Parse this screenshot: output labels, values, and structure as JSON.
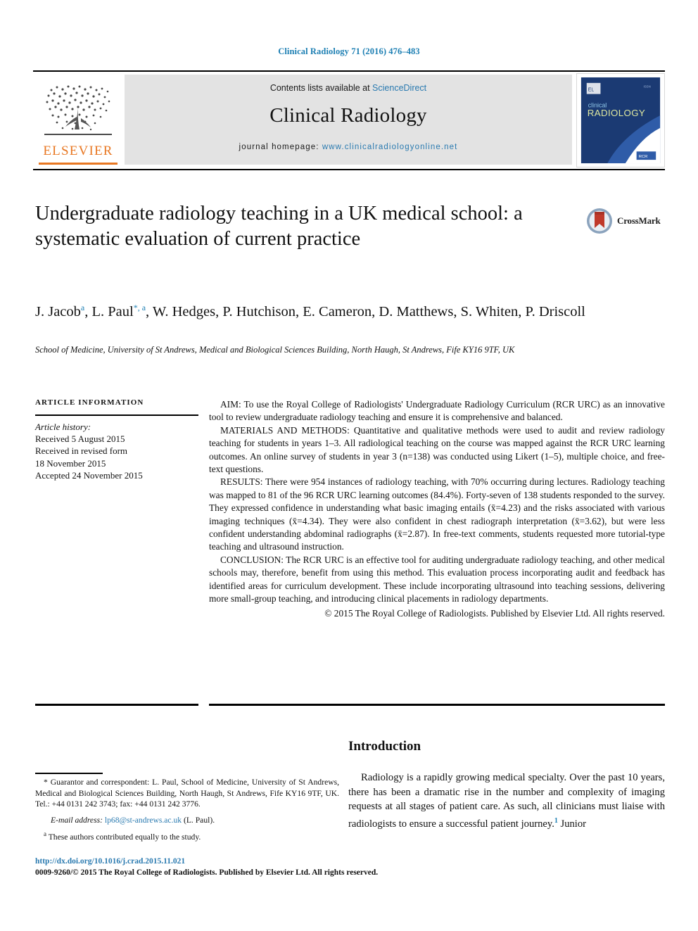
{
  "running_head": "Clinical Radiology 71 (2016) 476–483",
  "masthead": {
    "publisher_name": "ELSEVIER",
    "contents_prefix": "Contents lists available at ",
    "contents_link": "ScienceDirect",
    "journal_name": "Clinical Radiology",
    "homepage_prefix": "journal homepage: ",
    "homepage_url": "www.clinicalradiologyonline.net",
    "cover_title_small": "clinical",
    "cover_title_large": "RADIOLOGY",
    "accent_blue": "#2a7ab0",
    "elsevier_orange": "#e87722",
    "band_grey": "#e3e3e3"
  },
  "article": {
    "title": "Undergraduate radiology teaching in a UK medical school: a systematic evaluation of current practice",
    "crossmark_label": "CrossMark",
    "authors_line_1": "J. Jacob",
    "authors_sup_1": "a",
    "authors_line_2": ", L. Paul",
    "authors_sup_2": "*, a",
    "authors_line_3": ", W. Hedges, P. Hutchison, E. Cameron, D. Matthews, S. Whiten, P. Driscoll",
    "affiliation": "School of Medicine, University of St Andrews, Medical and Biological Sciences Building, North Haugh, St Andrews, Fife KY16 9TF, UK"
  },
  "article_information": {
    "heading": "ARTICLE INFORMATION",
    "history_label": "Article history:",
    "history_lines": [
      "Received 5 August 2015",
      "Received in revised form",
      "18 November 2015",
      "Accepted 24 November 2015"
    ]
  },
  "abstract": {
    "aim": "AIM: To use the Royal College of Radiologists' Undergraduate Radiology Curriculum (RCR URC) as an innovative tool to review undergraduate radiology teaching and ensure it is comprehensive and balanced.",
    "materials_and_methods": "MATERIALS AND METHODS: Quantitative and qualitative methods were used to audit and review radiology teaching for students in years 1–3. All radiological teaching on the course was mapped against the RCR URC learning outcomes. An online survey of students in year 3 (n=138) was conducted using Likert (1–5), multiple choice, and free-text questions.",
    "results": "RESULTS: There were 954 instances of radiology teaching, with 70% occurring during lectures. Radiology teaching was mapped to 81 of the 96 RCR URC learning outcomes (84.4%). Forty-seven of 138 students responded to the survey. They expressed confidence in understanding what basic imaging entails (x̄=4.23) and the risks associated with various imaging techniques (x̄=4.34). They were also confident in chest radiograph interpretation (x̄=3.62), but were less confident understanding abdominal radiographs (x̄=2.87). In free-text comments, students requested more tutorial-type teaching and ultrasound instruction.",
    "conclusion": "CONCLUSION: The RCR URC is an effective tool for auditing undergraduate radiology teaching, and other medical schools may, therefore, benefit from using this method. This evaluation process incorporating audit and feedback has identified areas for curriculum development. These include incorporating ultrasound into teaching sessions, delivering more small-group teaching, and introducing clinical placements in radiology departments.",
    "copyright": "© 2015 The Royal College of Radiologists. Published by Elsevier Ltd. All rights reserved."
  },
  "body": {
    "introduction_heading": "Introduction",
    "introduction_paragraph": "Radiology is a rapidly growing medical specialty. Over the past 10 years, there has been a dramatic rise in the number and complexity of imaging requests at all stages of patient care. As such, all clinicians must liaise with radiologists to ensure a successful patient journey.",
    "introduction_citation": "1",
    "introduction_tail": " Junior"
  },
  "footnotes": {
    "correspondence": "* Guarantor and correspondent: L. Paul, School of Medicine, University of St Andrews, Medical and Biological Sciences Building, North Haugh, St Andrews, Fife KY16 9TF, UK. Tel.: +44 0131 242 3743; fax: +44 0131 242 3776.",
    "email_label": "E-mail address:",
    "email_address": "lp68@st-andrews.ac.uk",
    "email_attribution": "(L. Paul).",
    "equal_contribution_sup": "a",
    "equal_contribution": "These authors contributed equally to the study."
  },
  "footer": {
    "doi": "http://dx.doi.org/10.1016/j.crad.2015.11.021",
    "issn_line": "0009-9260/© 2015 The Royal College of Radiologists. Published by Elsevier Ltd. All rights reserved."
  }
}
